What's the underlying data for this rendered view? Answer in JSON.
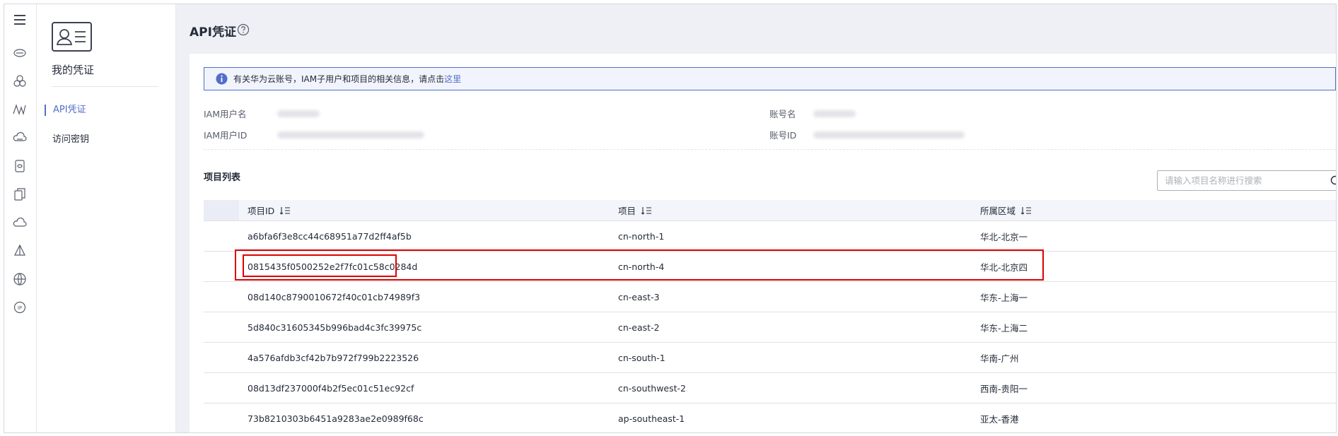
{
  "rail": {
    "icons": [
      "menu-icon",
      "cloud-storage-icon",
      "cluster-icon",
      "mountain-icon",
      "cloud-drive-icon",
      "database-icon",
      "document-copy-icon",
      "cloud-icon",
      "network-triangle-icon",
      "globe-icon",
      "ip-icon"
    ]
  },
  "sidebar": {
    "title": "我的凭证",
    "items": [
      {
        "label": "API凭证",
        "active": true
      },
      {
        "label": "访问密钥",
        "active": false
      }
    ]
  },
  "header": {
    "title": "API凭证"
  },
  "info": {
    "text": "有关华为云账号，IAM子用户和项目的相关信息，请点击",
    "link": "这里"
  },
  "meta": {
    "iam_user_name_label": "IAM用户名",
    "iam_user_id_label": "IAM用户ID",
    "account_name_label": "账号名",
    "account_id_label": "账号ID"
  },
  "projects": {
    "title": "项目列表",
    "search_placeholder": "请输入项目名称进行搜索",
    "columns": [
      "项目ID",
      "项目",
      "所属区域"
    ],
    "rows": [
      {
        "id": "a6bfa6f3e8cc44c68951a77d2ff4af5b",
        "project": "cn-north-1",
        "region": "华北-北京一"
      },
      {
        "id": "0815435f0500252e2f7fc01c58c0284d",
        "project": "cn-north-4",
        "region": "华北-北京四"
      },
      {
        "id": "08d140c8790010672f40c01cb74989f3",
        "project": "cn-east-3",
        "region": "华东-上海一"
      },
      {
        "id": "5d840c31605345b996bad4c3fc39975c",
        "project": "cn-east-2",
        "region": "华东-上海二"
      },
      {
        "id": "4a576afdb3cf42b7b972f799b2223526",
        "project": "cn-south-1",
        "region": "华南-广州"
      },
      {
        "id": "08d13df237000f4b2f5ec01c51ec92cf",
        "project": "cn-southwest-2",
        "region": "西南-贵阳一"
      },
      {
        "id": "73b8210303b6451a9283ae2e0989f68c",
        "project": "ap-southeast-1",
        "region": "亚太-香港"
      }
    ]
  },
  "colors": {
    "accent": "#526ecc",
    "highlight": "#e00000"
  }
}
